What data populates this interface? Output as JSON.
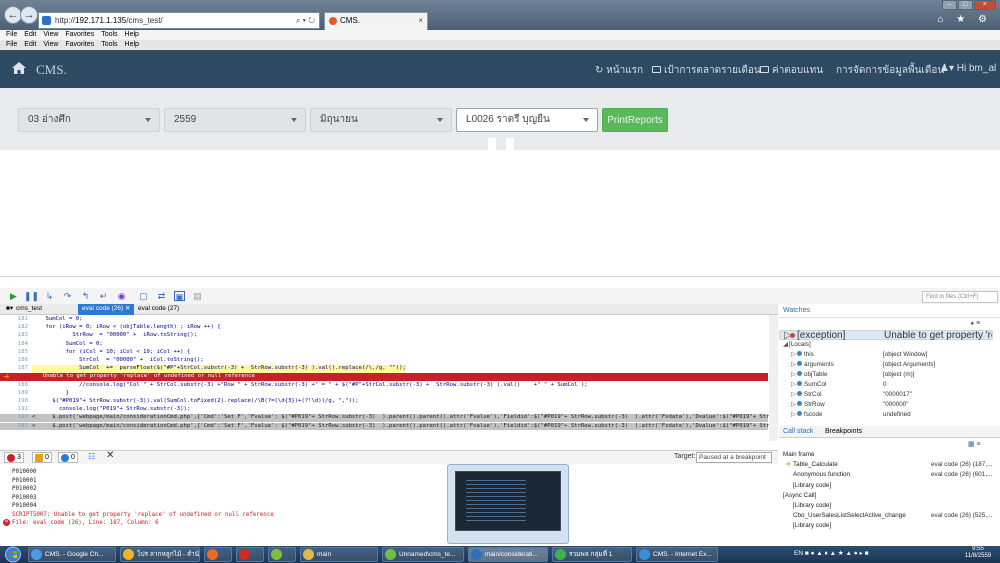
{
  "browser": {
    "address_prefix": "http://",
    "address_host": "192.171.1.135",
    "address_path": "/cms_test/",
    "address_tools": "⌕ ▾ ↻",
    "tab_title": "CMS.",
    "tab_close": "×",
    "window_buttons": [
      "–",
      "□",
      "×"
    ],
    "toolbar_icons": "⌂ ★ ⚙"
  },
  "menu_bar_1": [
    "File",
    "Edit",
    "View",
    "Favorites",
    "Tools",
    "Help"
  ],
  "menu_bar_2": [
    "File",
    "Edit",
    "View",
    "Favorites",
    "Tools",
    "Help"
  ],
  "site": {
    "brand": "CMS.",
    "nav": [
      {
        "label": "หน้าแรก"
      },
      {
        "label": "เป้าการตลาดรายเดือน"
      },
      {
        "label": "ค่าตอบแทน"
      },
      {
        "label": "การจัดการข้อมูลพื้นเดือน"
      }
    ],
    "user": "▾ Hi bm_al"
  },
  "filters": {
    "branch": "03 อ่างศึก",
    "year": "2559",
    "month": "มิถุนายน",
    "staff": "L0026 ราตรี บุญยืน",
    "print_button": "PrintReports"
  },
  "devtools": {
    "find_placeholder": "Find in files (Ctrl+F)",
    "file_tabs": [
      "cms_test",
      "eval code (26)",
      "eval code (27)"
    ],
    "code_lines": [
      {
        "n": "181",
        "t": "    SumCol = 0;",
        "k": ""
      },
      {
        "n": "182",
        "t": "    for (iRow = 0; iRow < (objTable.length) ; iRow ++) {",
        "k": ""
      },
      {
        "n": "183",
        "t": "            StrRow  = \"00000\" +  iRow.toString();",
        "k": ""
      },
      {
        "n": "184",
        "t": "          SumCol = 0;",
        "k": ""
      },
      {
        "n": "185",
        "t": "          for (iCol = 10; iCol < 19; iCol ++) {",
        "k": ""
      },
      {
        "n": "186",
        "t": "              StrCol  = \"00000\" +  iCol.toString();",
        "k": ""
      },
      {
        "n": "187",
        "t": "              SumCol  +=  parseFloat($(\"#P\"+StrCol.substr(-3) +  StrRow.substr(-3) ).val().replace(/\\,/g, \"\"));",
        "k": "bp"
      },
      {
        "n": "",
        "t": "  Unable to get property 'replace' of undefined or null reference",
        "k": "err"
      },
      {
        "n": "188",
        "t": "              //console.log(\"Col \" + StrCol.substr(-3) +\"Row \" + StrRow.substr(-3) +\" = \" + $(\"#P\"+StrCol.substr(-3) +  StrRow.substr(-3) ).val()    +\" \" + SumCol );",
        "k": ""
      },
      {
        "n": "189",
        "t": "          }",
        "k": ""
      },
      {
        "n": "190",
        "t": "      $(\"#P019\"+ StrRow.substr(-3)).val(SumCol.toFixed(2).replace(/\\B(?=(\\d{3})+(?!\\d))/g, \",\"));",
        "k": ""
      },
      {
        "n": "191",
        "t": "        console.log(\"P019\"+ StrRow.substr(-3));",
        "k": ""
      },
      {
        "n": "192",
        "t": "<     $.post('webpage/main/considerationCmd.php',{'Cmd':'Set F','Fvalue': $(\"#P019\"+ StrRow.substr(-3)  ).parent().parent().attr('Fvalue'),'Fieldid':$(\"#P019\"+ StrRow.substr(-3)  ).attr('Fsdata'),'Dvalue':$(\"#P019\"+ StrRow.su",
        "k": "gray"
      },
      {
        "n": "192",
        "t": "<     $.post('webpage/main/considerationCmd.php',{'Cmd':'Set F','Fvalue': $(\"#P019\"+ StrRow.substr(-3)  ).parent().parent().attr('Fvalue'),'Fieldid':$(\"#P019\"+ StrRow.substr(-3)  ).attr('Fsdata'),'Dvalue':$(\"#P019\"+ StrRow.su",
        "k": "gray"
      }
    ],
    "console_counts": {
      "errors": "3",
      "warnings": "0",
      "info": "0"
    },
    "target_label": "Target:",
    "target_value": "Paused at a breakpoint",
    "console_lines": [
      {
        "t": "P010000",
        "k": ""
      },
      {
        "t": "P010001",
        "k": ""
      },
      {
        "t": "P010002",
        "k": ""
      },
      {
        "t": "P010003",
        "k": ""
      },
      {
        "t": "P010004",
        "k": ""
      },
      {
        "t": "SCRIPT5007: Unable to get property 'replace' of undefined or null reference",
        "k": "err"
      },
      {
        "t": "File: eval code (26), Line: 187, Column: 6",
        "k": "err"
      }
    ],
    "watches_title": "Watches",
    "watch_rows": [
      {
        "name": "[exception]",
        "value": "Unable to get property 'replace'...",
        "indent": 0,
        "sel": true,
        "dot": "r"
      },
      {
        "name": "[Locals]",
        "value": "",
        "indent": 0,
        "sel": false,
        "dot": ""
      },
      {
        "name": "this",
        "value": "[object Window]",
        "indent": 1,
        "sel": false,
        "dot": "b"
      },
      {
        "name": "arguments",
        "value": "[object Arguments]",
        "indent": 1,
        "sel": false,
        "dot": "b"
      },
      {
        "name": "objTable",
        "value": "[object (m)]",
        "indent": 1,
        "sel": false,
        "dot": "b"
      },
      {
        "name": "SumCol",
        "value": "0",
        "indent": 1,
        "sel": false,
        "dot": "b"
      },
      {
        "name": "StrCol",
        "value": "\"0000017\"",
        "indent": 1,
        "sel": false,
        "dot": "b"
      },
      {
        "name": "StrRow",
        "value": "\"000000\"",
        "indent": 1,
        "sel": false,
        "dot": "b"
      },
      {
        "name": "fscode",
        "value": "undefined",
        "indent": 1,
        "sel": false,
        "dot": "b"
      }
    ],
    "callstack_tabs": [
      "Call stack",
      "Breakpoints"
    ],
    "callstack_rows": [
      {
        "name": "Main frame",
        "value": "",
        "indent": 0
      },
      {
        "name": "Table_Calculate",
        "value": "eval code (26) (187,...",
        "indent": 1
      },
      {
        "name": "Anonymous function",
        "value": "eval code (26) (601,...",
        "indent": 1
      },
      {
        "name": "[Library code]",
        "value": "",
        "indent": 1
      },
      {
        "name": "[Async Call]",
        "value": "",
        "indent": 0
      },
      {
        "name": "[Library code]",
        "value": "",
        "indent": 1
      },
      {
        "name": "Cbo_UserSalesListSelectActive_change",
        "value": "eval code (26) (525,...",
        "indent": 1
      },
      {
        "name": "[Library code]",
        "value": "",
        "indent": 1
      }
    ]
  },
  "taskbar": {
    "items": [
      {
        "label": "CMS. - Google Ch...",
        "color": "#4a9be0"
      },
      {
        "label": "โปร ลากหลูกไม้ - สำนัก...",
        "color": "#f0b429"
      },
      {
        "label": "",
        "color": "#e86a1e"
      },
      {
        "label": "",
        "color": "#d3291f"
      },
      {
        "label": "",
        "color": "#7fbf3f"
      },
      {
        "label": "main",
        "color": "#e3b84a"
      },
      {
        "label": "Unnamed\\cms_te...",
        "color": "#6fbf4a"
      },
      {
        "label": "main/considerati...",
        "color": "#2e6fbf"
      },
      {
        "label": "รวมพล กลุ่มที่ 1",
        "color": "#3cb44b"
      },
      {
        "label": "CMS. - Internet Ex...",
        "color": "#3b8fd9"
      }
    ],
    "lang": "EN",
    "time": "9:55",
    "date": "11/8/2559"
  }
}
